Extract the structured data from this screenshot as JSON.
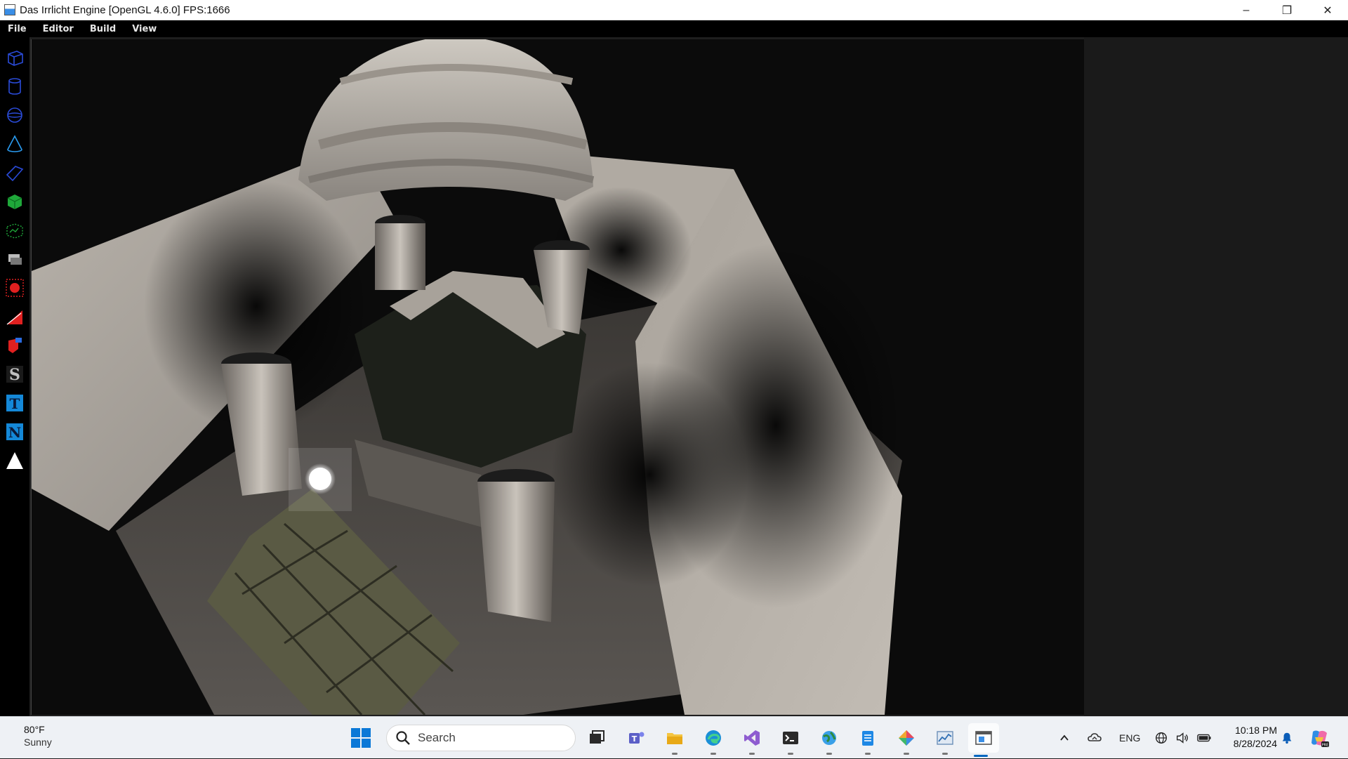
{
  "window": {
    "title": "Das Irrlicht Engine  [OpenGL 4.6.0] FPS:1666",
    "minimize_glyph": "–",
    "restore_glyph": "❐",
    "close_glyph": "✕"
  },
  "menu": {
    "items": [
      {
        "label": "File"
      },
      {
        "label": "Editor"
      },
      {
        "label": "Build"
      },
      {
        "label": "View"
      }
    ]
  },
  "toolbar": {
    "tools": [
      {
        "name": "cube-wireframe-icon",
        "color": "#2a4bd8"
      },
      {
        "name": "cylinder-wireframe-icon",
        "color": "#2a4bd8"
      },
      {
        "name": "sphere-wireframe-icon",
        "color": "#2a4bd8"
      },
      {
        "name": "cone-wireframe-icon",
        "color": "#2a9bf0"
      },
      {
        "name": "plane-wireframe-icon",
        "color": "#2a4bd8"
      },
      {
        "name": "green-cube-icon",
        "color": "#1fa83a"
      },
      {
        "name": "terrain-icon",
        "color": "#1fa83a"
      },
      {
        "name": "billboard-icon",
        "color": "#aaaaaa"
      },
      {
        "name": "point-light-icon",
        "color": "#e02020"
      },
      {
        "name": "spot-light-icon",
        "color": "#e02020"
      },
      {
        "name": "directional-light-icon",
        "color": "#e02020"
      },
      {
        "name": "skybox-icon",
        "color": "#aaaaaa"
      },
      {
        "name": "text-icon",
        "color": "#1488d8"
      },
      {
        "name": "node-icon",
        "color": "#1488d8"
      },
      {
        "name": "triangle-icon",
        "color": "#ffffff"
      }
    ],
    "skybox_letter": "S",
    "text_letter": "T",
    "node_letter": "N"
  },
  "taskbar": {
    "weather_temp": "80°F",
    "weather_condition": "Sunny",
    "search_placeholder": "Search",
    "apps": [
      {
        "name": "task-view-icon"
      },
      {
        "name": "teams-icon"
      },
      {
        "name": "file-explorer-icon"
      },
      {
        "name": "edge-icon"
      },
      {
        "name": "visual-studio-icon"
      },
      {
        "name": "terminal-icon"
      },
      {
        "name": "globe-app-icon"
      },
      {
        "name": "notepad-icon"
      },
      {
        "name": "paint-app-icon"
      },
      {
        "name": "performance-monitor-icon"
      },
      {
        "name": "irrlicht-window-icon"
      }
    ],
    "language": "ENG",
    "time": "10:18 PM",
    "date": "8/28/2024"
  },
  "colors": {
    "accent": "#0067c0",
    "toolbar_bg": "#000000",
    "viewport_bg": "#0a0a0a"
  }
}
